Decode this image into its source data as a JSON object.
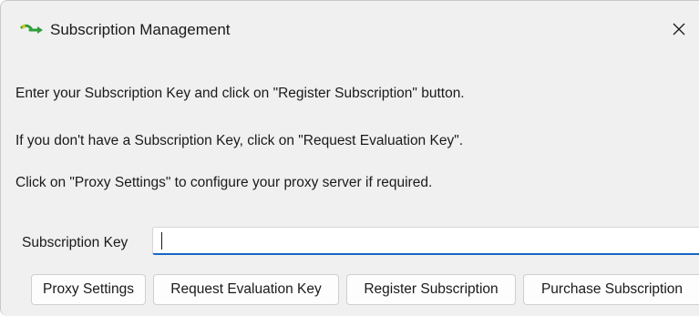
{
  "window": {
    "title": "Subscription Management",
    "icon": "green-arrow-icon",
    "close_icon": "close-icon"
  },
  "messages": {
    "line1": "Enter your Subscription Key and click on \"Register Subscription\" button.",
    "line2": "If you don't have a Subscription Key, click on \"Request Evaluation Key\".",
    "line3": "Click on \"Proxy Settings\" to configure your proxy server if required."
  },
  "subscription_key": {
    "label": "Subscription Key",
    "value": ""
  },
  "buttons": {
    "proxy_settings": "Proxy Settings",
    "request_evaluation_key": "Request Evaluation Key",
    "register_subscription": "Register Subscription",
    "purchase_subscription": "Purchase Subscription"
  },
  "colors": {
    "window_bg": "#f0f0f0",
    "input_focus_underline": "#1666c5",
    "icon_green": "#2e9e3a",
    "icon_yellow": "#d7c21f"
  }
}
